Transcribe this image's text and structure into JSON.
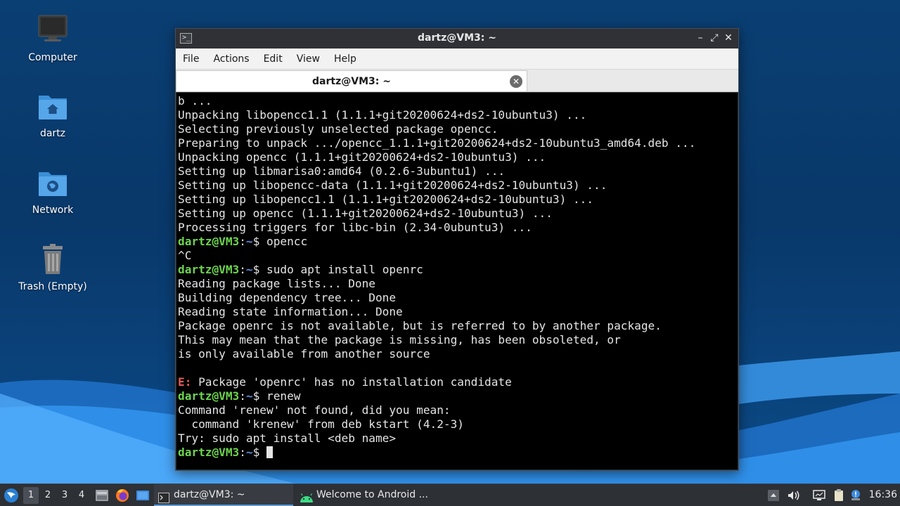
{
  "desktop": {
    "icons": [
      {
        "label": "Computer"
      },
      {
        "label": "dartz"
      },
      {
        "label": "Network"
      },
      {
        "label": "Trash (Empty)"
      }
    ]
  },
  "window": {
    "title": "dartz@VM3: ~",
    "icon_text": ">_",
    "controls": {
      "minimize": "–",
      "maximize": "⤢",
      "close": "✕"
    },
    "menu": [
      "File",
      "Actions",
      "Edit",
      "View",
      "Help"
    ],
    "tab": {
      "label": "dartz@VM3: ~",
      "close": "✕"
    }
  },
  "terminal": {
    "prompt_user": "dartz@VM3",
    "prompt_sep": ":",
    "prompt_path": "~",
    "prompt_symbol": "$ ",
    "lines": [
      {
        "kind": "out",
        "text": "b ..."
      },
      {
        "kind": "out",
        "text": "Unpacking libopencc1.1 (1.1.1+git20200624+ds2-10ubuntu3) ..."
      },
      {
        "kind": "out",
        "text": "Selecting previously unselected package opencc."
      },
      {
        "kind": "out",
        "text": "Preparing to unpack .../opencc_1.1.1+git20200624+ds2-10ubuntu3_amd64.deb ..."
      },
      {
        "kind": "out",
        "text": "Unpacking opencc (1.1.1+git20200624+ds2-10ubuntu3) ..."
      },
      {
        "kind": "out",
        "text": "Setting up libmarisa0:amd64 (0.2.6-3ubuntu1) ..."
      },
      {
        "kind": "out",
        "text": "Setting up libopencc-data (1.1.1+git20200624+ds2-10ubuntu3) ..."
      },
      {
        "kind": "out",
        "text": "Setting up libopencc1.1 (1.1.1+git20200624+ds2-10ubuntu3) ..."
      },
      {
        "kind": "out",
        "text": "Setting up opencc (1.1.1+git20200624+ds2-10ubuntu3) ..."
      },
      {
        "kind": "out",
        "text": "Processing triggers for libc-bin (2.34-0ubuntu3) ..."
      },
      {
        "kind": "prompt",
        "text": "opencc"
      },
      {
        "kind": "out",
        "text": "^C"
      },
      {
        "kind": "prompt",
        "text": "sudo apt install openrc"
      },
      {
        "kind": "out",
        "text": "Reading package lists... Done"
      },
      {
        "kind": "out",
        "text": "Building dependency tree... Done"
      },
      {
        "kind": "out",
        "text": "Reading state information... Done"
      },
      {
        "kind": "out",
        "text": "Package openrc is not available, but is referred to by another package."
      },
      {
        "kind": "out",
        "text": "This may mean that the package is missing, has been obsoleted, or"
      },
      {
        "kind": "out",
        "text": "is only available from another source"
      },
      {
        "kind": "out",
        "text": ""
      },
      {
        "kind": "error",
        "prefix": "E:",
        "text": " Package 'openrc' has no installation candidate"
      },
      {
        "kind": "prompt",
        "text": "renew"
      },
      {
        "kind": "out",
        "text": "Command 'renew' not found, did you mean:"
      },
      {
        "kind": "out",
        "text": "  command 'krenew' from deb kstart (4.2-3)"
      },
      {
        "kind": "out",
        "text": "Try: sudo apt install <deb name>"
      },
      {
        "kind": "prompt_cursor",
        "text": ""
      }
    ]
  },
  "taskbar": {
    "workspaces": [
      "1",
      "2",
      "3",
      "4"
    ],
    "active_workspace": "1",
    "tasks": [
      {
        "label": "dartz@VM3: ~",
        "icon": "terminal-icon",
        "active": true
      },
      {
        "label": "Welcome to Android ...",
        "icon": "android-icon",
        "active": false
      }
    ],
    "clock": "16:36",
    "colors": {
      "accent": "#5b9bd5",
      "prompt_user": "#6cd44d",
      "prompt_path": "#5b8fe0",
      "error": "#e65a5a"
    }
  }
}
